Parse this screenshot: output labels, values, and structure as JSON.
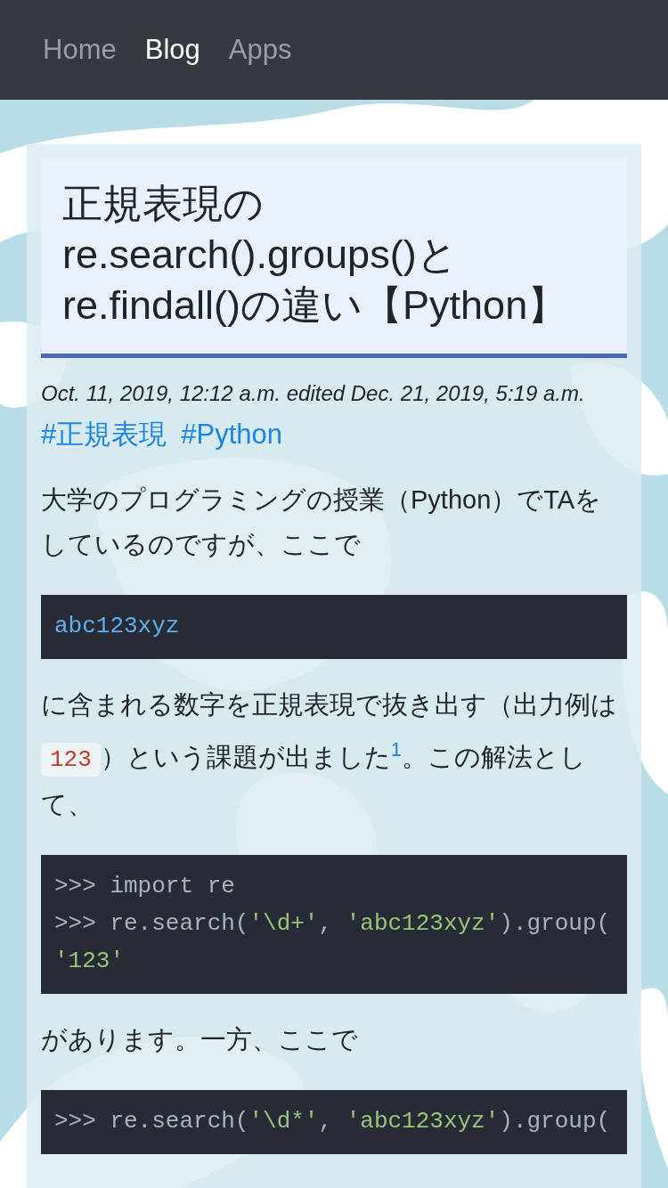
{
  "nav": [
    {
      "label": "Home",
      "selected": false
    },
    {
      "label": "Blog",
      "selected": true
    },
    {
      "label": "Apps",
      "selected": false
    }
  ],
  "article": {
    "title": "正規表現のre.search().groups()とre.findall()の違い【Python】",
    "date": "Oct. 11, 2019, 12:12 a.m. edited Dec. 21, 2019, 5:19 a.m.",
    "tags": [
      "#正規表現",
      "#Python"
    ],
    "blocks": [
      {
        "kind": "paragraph",
        "parts": [
          {
            "kind": "text",
            "text": "大学のプログラミングの授業（Python）でTAをしているのですが、ここで"
          }
        ]
      },
      {
        "kind": "code",
        "lines": [
          [
            {
              "kind": "name",
              "text": "abc123xyz"
            }
          ]
        ]
      },
      {
        "kind": "paragraph",
        "parts": [
          {
            "kind": "text",
            "text": "に含まれる数字を正規表現で抜き出す（出力例は"
          },
          {
            "kind": "code",
            "text": "123"
          },
          {
            "kind": "text",
            "text": "）という課題が出ました"
          },
          {
            "kind": "footnote",
            "text": "1"
          },
          {
            "kind": "text",
            "text": "。この解法として、"
          }
        ]
      },
      {
        "kind": "code",
        "lines": [
          [
            {
              "kind": "plain",
              "text": ">>> import re"
            }
          ],
          [
            {
              "kind": "plain",
              "text": ">>> re.search("
            },
            {
              "kind": "string",
              "text": "'\\d+'"
            },
            {
              "kind": "plain",
              "text": ", "
            },
            {
              "kind": "string",
              "text": "'abc123xyz'"
            },
            {
              "kind": "plain",
              "text": ").group("
            }
          ],
          [
            {
              "kind": "string",
              "text": "'123'"
            }
          ]
        ]
      },
      {
        "kind": "paragraph",
        "parts": [
          {
            "kind": "text",
            "text": "があります。一方、ここで"
          }
        ]
      },
      {
        "kind": "code",
        "lines": [
          [
            {
              "kind": "plain",
              "text": ">>> re.search("
            },
            {
              "kind": "string",
              "text": "'\\d*'"
            },
            {
              "kind": "plain",
              "text": ", "
            },
            {
              "kind": "string",
              "text": "'abc123xyz'"
            },
            {
              "kind": "plain",
              "text": ").group("
            }
          ]
        ]
      }
    ]
  }
}
